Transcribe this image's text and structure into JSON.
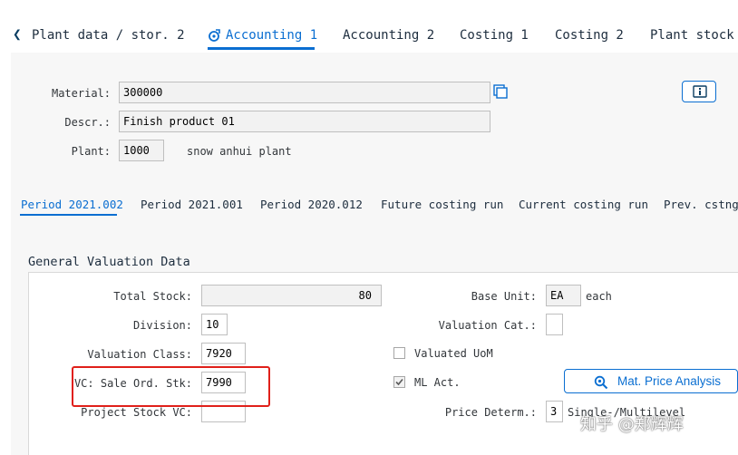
{
  "top_tabs": {
    "back_icon": "chevron-left-icon",
    "items": [
      {
        "label": "Plant data / stor. 2"
      },
      {
        "label": "Accounting 1",
        "active": true,
        "icon": "accounting-icon"
      },
      {
        "label": "Accounting 2"
      },
      {
        "label": "Costing 1"
      },
      {
        "label": "Costing 2"
      },
      {
        "label": "Plant stock"
      }
    ]
  },
  "header": {
    "material_label": "Material:",
    "material_value": "300000",
    "descr_label": "Descr.:",
    "descr_value": "Finish product 01",
    "plant_label": "Plant:",
    "plant_value": "1000",
    "plant_name": "snow anhui plant",
    "info_icon": "info-icon",
    "copy_icon": "copy-icon"
  },
  "period_tabs": [
    {
      "label": "Period 2021.002",
      "active": true
    },
    {
      "label": "Period 2021.001"
    },
    {
      "label": "Period 2020.012"
    },
    {
      "label": "Future costing run"
    },
    {
      "label": "Current costing run"
    },
    {
      "label": "Prev. cstng"
    }
  ],
  "valuation": {
    "title": "General Valuation Data",
    "total_stock_label": "Total Stock:",
    "total_stock_value": "80",
    "base_unit_label": "Base Unit:",
    "base_unit_value": "EA",
    "base_unit_text": "each",
    "division_label": "Division:",
    "division_value": "10",
    "valuation_cat_label": "Valuation Cat.:",
    "valuation_cat_value": "",
    "valuation_class_label": "Valuation Class:",
    "valuation_class_value": "7920",
    "valuated_uom_label": "Valuated UoM",
    "valuated_uom_checked": false,
    "vc_sale_label": "VC: Sale Ord. Stk:",
    "vc_sale_value": "7990",
    "ml_act_label": "ML Act.",
    "ml_act_checked": true,
    "mat_price_button": "Mat. Price Analysis",
    "project_stock_label": "Project Stock VC:",
    "project_stock_value": "",
    "price_determ_label": "Price Determ.:",
    "price_determ_value": "3",
    "price_determ_text": "Single-/Multilevel"
  },
  "watermark": "知乎 @郑辉辉",
  "colors": {
    "accent": "#0a6ed1",
    "highlight": "#e0201a"
  }
}
